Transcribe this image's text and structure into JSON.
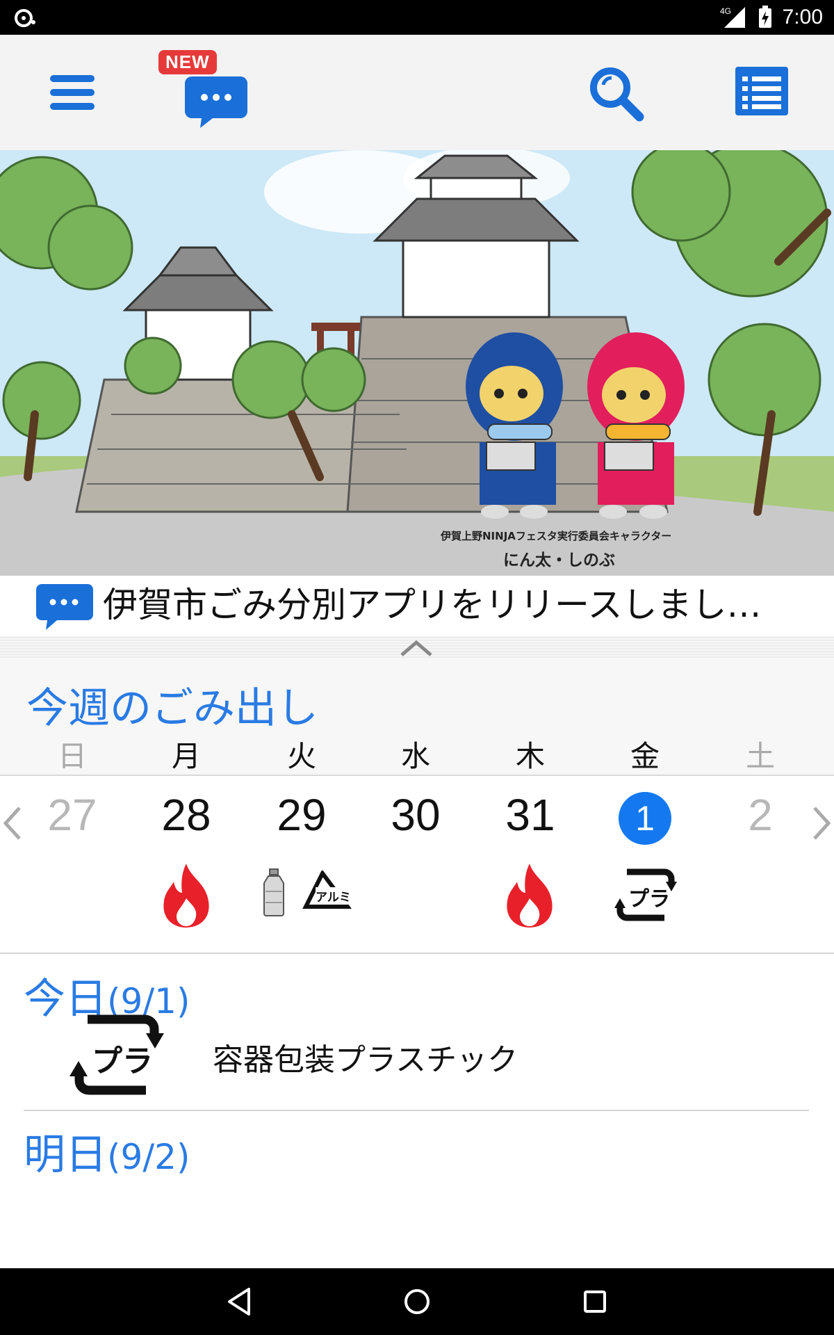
{
  "status_bar": {
    "network": "4G",
    "time": "7:00"
  },
  "toolbar": {
    "new_badge": "NEW",
    "icons": [
      "menu-icon",
      "chat-icon",
      "search-icon",
      "list-icon"
    ],
    "accent_color": "#1a6fd8"
  },
  "banner": {
    "credit_line1": "伊賀上野NINJAフェスタ実行委員会キャラクター",
    "credit_line2": "にん太・しのぶ"
  },
  "news": {
    "text": "伊賀市ごみ分別アプリをリリースしまし…"
  },
  "week": {
    "title": "今週のごみ出し",
    "weekdays": [
      "日",
      "月",
      "火",
      "水",
      "木",
      "金",
      "土"
    ],
    "days": [
      "27",
      "28",
      "29",
      "30",
      "31",
      "1",
      "2"
    ],
    "today_index": 5,
    "can_label": "アルミ",
    "pla_label": "プラ"
  },
  "today": {
    "label": "今日",
    "date": "(9/1)",
    "item": "容器包装プラスチック"
  },
  "tomorrow": {
    "label": "明日",
    "date": "(9/2)"
  },
  "colors": {
    "accent_blue": "#2a7be4",
    "today_circle": "#1479f0",
    "fire_red": "#e8202a",
    "new_badge": "#e63a3a"
  }
}
